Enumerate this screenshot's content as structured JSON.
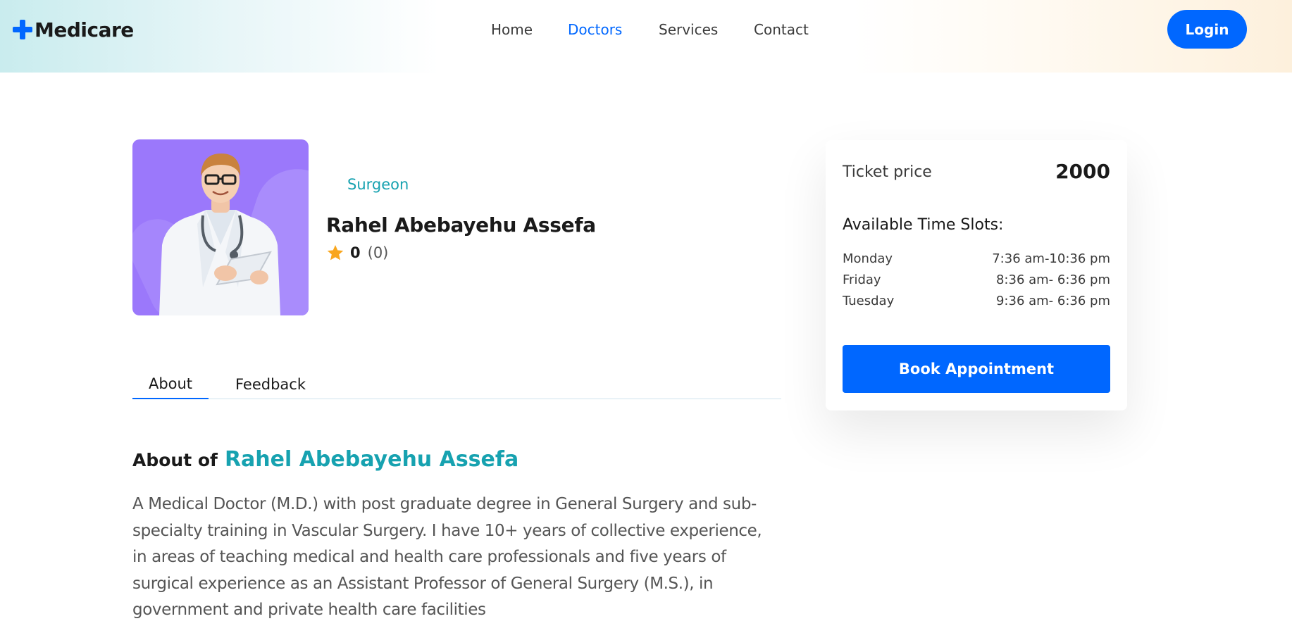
{
  "header": {
    "logo_text": "Medicare",
    "nav": [
      {
        "label": "Home"
      },
      {
        "label": "Doctors",
        "active": true
      },
      {
        "label": "Services"
      },
      {
        "label": "Contact"
      }
    ],
    "login_label": "Login"
  },
  "doctor": {
    "speciality": "Surgeon",
    "name": "Rahel Abebayehu Assefa",
    "rating": "0",
    "reviews": "(0)"
  },
  "tabs": [
    {
      "label": "About",
      "active": true
    },
    {
      "label": "Feedback"
    }
  ],
  "about": {
    "prefix": "About of",
    "name": "Rahel Abebayehu Assefa",
    "text": "A Medical Doctor (M.D.) with post graduate degree in General Surgery and sub-specialty training in Vascular Surgery. I have 10+ years of collective experience, in areas of teaching medical and health care professionals and five years of surgical experience as an Assistant Professor of General Surgery (M.S.), in government and private health care facilities"
  },
  "booking": {
    "ticket_label": "Ticket price",
    "ticket_price": "2000",
    "slots_title": "Available Time Slots:",
    "slots": [
      {
        "day": "Monday",
        "time": "7:36 am-10:36 pm"
      },
      {
        "day": "Friday",
        "time": "8:36 am- 6:36 pm"
      },
      {
        "day": "Tuesday",
        "time": "9:36 am- 6:36 pm"
      }
    ],
    "button_label": "Book Appointment"
  },
  "colors": {
    "primary": "#0067ff",
    "accent": "#17a2b0",
    "photo_bg": "#9b78fb",
    "star": "#f9a61d"
  }
}
